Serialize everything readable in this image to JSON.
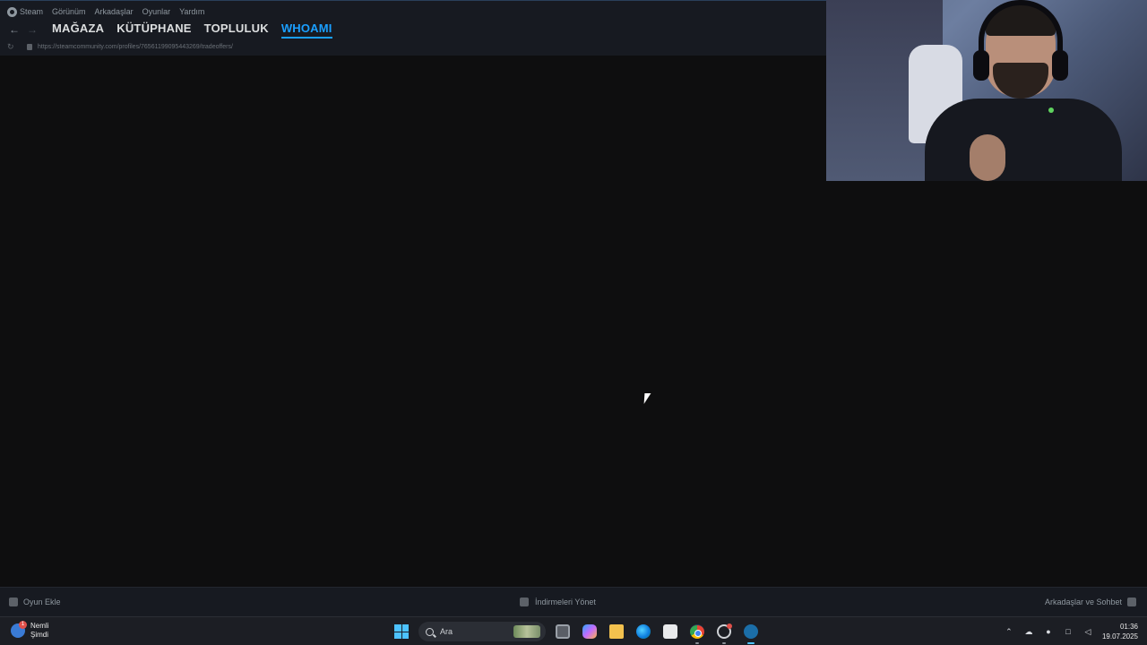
{
  "menubar": {
    "items": [
      "Steam",
      "Görünüm",
      "Arkadaşlar",
      "Oyunlar",
      "Yardım"
    ]
  },
  "nav": {
    "tabs": [
      "MAĞAZA",
      "KÜTÜPHANE",
      "TOPLULUK",
      "WHOAMI"
    ],
    "active_tab": "WHOAMI"
  },
  "url": "https://steamcommunity.com/profiles/76561199095443269/tradeoffers/",
  "bottombar": {
    "add_game": "Oyun Ekle",
    "manage_downloads": "İndirmeleri Yönet",
    "friends_chat": "Arkadaşlar ve Sohbet"
  },
  "taskbar": {
    "weather_title": "Nemli",
    "weather_subtitle": "Şimdi",
    "weather_badge": "1",
    "search_placeholder": "Ara",
    "time": "01:36",
    "date": "19.07.2025"
  },
  "colors": {
    "accent": "#1a9fff",
    "chrome_bg": "#171a21",
    "content_bg": "#0e0e0f"
  }
}
